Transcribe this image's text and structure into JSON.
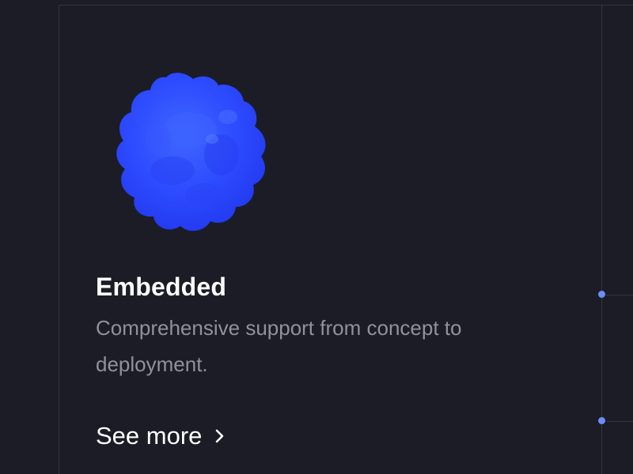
{
  "card": {
    "title": "Embedded",
    "description": "Comprehensive support from concept to deployment.",
    "see_more_label": "See more",
    "illustration": "blue-blob-sphere",
    "chevron_icon": "chevron-right-icon"
  },
  "colors": {
    "background": "#1b1c26",
    "frame_line": "#33353f",
    "accent_node": "#6d8cf4",
    "blob": "#2f4cff",
    "title": "#ffffff",
    "description": "#8f919c"
  }
}
